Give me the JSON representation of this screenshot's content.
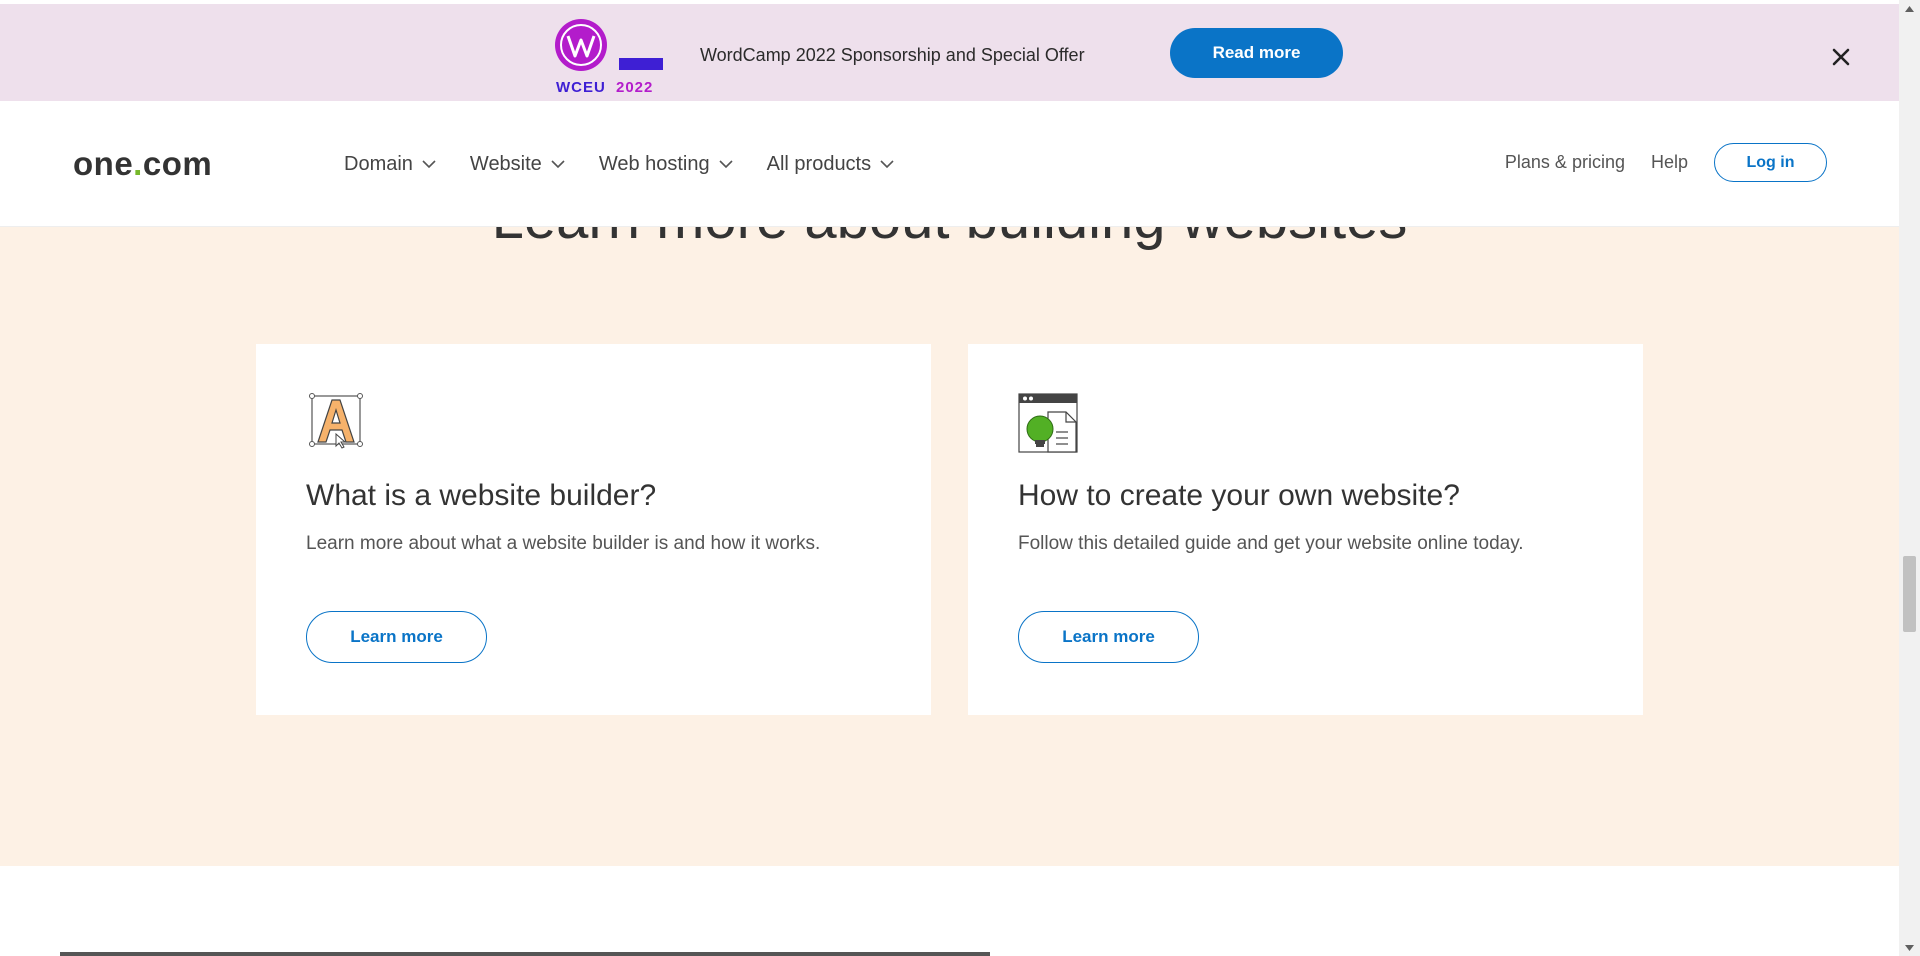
{
  "banner": {
    "logo_text": "WCEU",
    "logo_year": "2022",
    "text": "WordCamp 2022 Sponsorship and Special Offer",
    "button_label": "Read more"
  },
  "header": {
    "logo_left": "one",
    "logo_dot": ".",
    "logo_right": "com",
    "nav": [
      {
        "label": "Domain"
      },
      {
        "label": "Website"
      },
      {
        "label": "Web hosting"
      },
      {
        "label": "All products"
      }
    ],
    "plans_label": "Plans & pricing",
    "help_label": "Help",
    "login_label": "Log in"
  },
  "section": {
    "title": "Learn more about building websites",
    "cards": [
      {
        "title": "What is a website builder?",
        "description": "Learn more about what a website builder is and how it works.",
        "button_label": "Learn more"
      },
      {
        "title": "How to create your own website?",
        "description": "Follow this detailed guide and get your website online today.",
        "button_label": "Learn more"
      }
    ]
  },
  "colors": {
    "accent_blue": "#0a74c7",
    "banner_bg": "#eee0ec",
    "section_bg": "#fdf1e5",
    "logo_dot_green": "#76b82a",
    "wp_purple": "#b31ccb"
  },
  "icons": {
    "banner_close": "close-icon",
    "nav_dropdown": "chevron-down-icon",
    "card1": "font-editor-icon",
    "card2": "lightbulb-document-icon"
  }
}
